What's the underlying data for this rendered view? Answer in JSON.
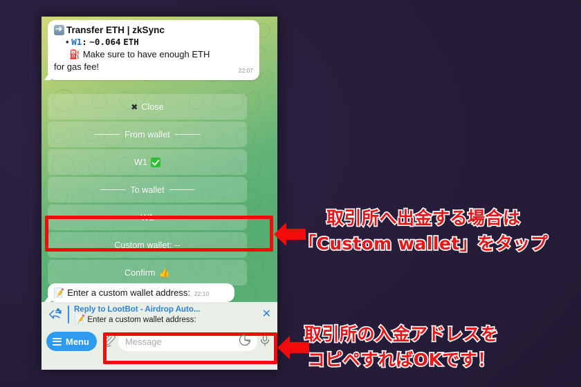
{
  "background": {
    "color": "#271d3a"
  },
  "phone": {
    "chat": {
      "background_gradient_from": "#cfd97a",
      "background_gradient_to": "#56ad72",
      "messages": [
        {
          "id": "transfer-eth",
          "icon": "arrow-right-icon",
          "title": "Transfer ETH | zkSync",
          "bullet": "•",
          "wallet_label": "W1",
          "wallet_sep": ":",
          "amount": "~0.064",
          "currency": "ETH",
          "gas_icon": "fuel-pump-icon",
          "gas_note_line1": "Make sure to have enough ETH",
          "gas_note_line2": "for gas fee!",
          "timestamp": "22:07"
        },
        {
          "id": "custom-wallet-prompt",
          "icon": "memo-icon",
          "text": "Enter a custom wallet address:",
          "timestamp": "22:10"
        }
      ],
      "keyboard": [
        {
          "id": "close",
          "icon": "cross-mark-icon",
          "label": "Close",
          "style": "icon-left"
        },
        {
          "id": "from-wallet",
          "label": "From wallet",
          "style": "divider"
        },
        {
          "id": "w1-selected",
          "label": "W1",
          "badge": "check-mark-icon",
          "style": "badge"
        },
        {
          "id": "to-wallet",
          "label": "To wallet",
          "style": "divider"
        },
        {
          "id": "w1",
          "label": "W1",
          "style": "plain"
        },
        {
          "id": "custom-wallet",
          "label": "Custom wallet: --",
          "style": "plain",
          "highlighted": true
        },
        {
          "id": "confirm",
          "label": "Confirm",
          "badge": "thumbs-up-icon",
          "style": "emoji-right"
        }
      ]
    },
    "reply_bar": {
      "icon": "reply-icon",
      "title": "Reply to LootBot - Airdrop Auto...",
      "subtitle_icon": "memo-icon",
      "subtitle": "Enter a custom wallet address:",
      "close_icon": "close-icon",
      "close_label": "✕"
    },
    "composer": {
      "menu_icon": "hamburger-icon",
      "menu_label": "Menu",
      "attach_icon": "paperclip-icon",
      "message_placeholder": "Message",
      "sticker_icon": "sticker-icon",
      "mic_icon": "microphone-icon"
    }
  },
  "annotations": {
    "highlight_color": "#f30a0a",
    "text_color": "#e4171a",
    "text_outline_color": "#ffffff",
    "callouts": [
      {
        "id": "callout-custom-wallet",
        "arrow_icon": "arrow-left-icon",
        "lines": [
          "取引所へ出金する場合は",
          "「Custom wallet」をタップ"
        ]
      },
      {
        "id": "callout-paste-address",
        "arrow_icon": "arrow-left-icon",
        "lines": [
          "取引所の入金アドレスを",
          "コピペすればOKです！"
        ]
      }
    ]
  }
}
